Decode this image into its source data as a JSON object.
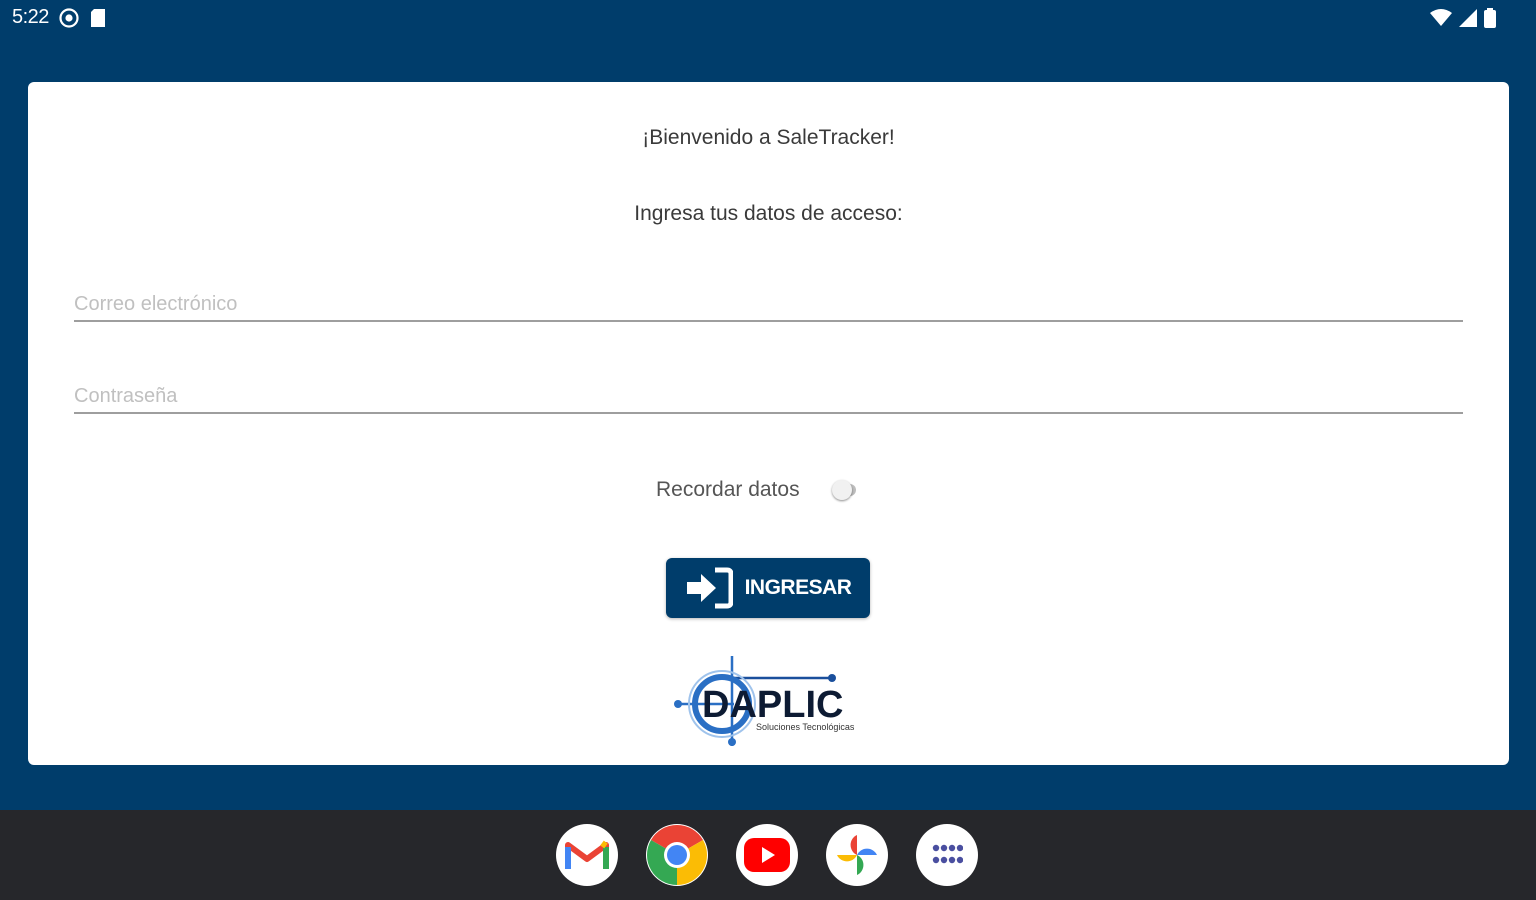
{
  "status_bar": {
    "time": "5:22",
    "left_icons": [
      "settings-circle-icon",
      "sd-card-icon"
    ],
    "right_icons": [
      "wifi-icon",
      "cell-signal-icon",
      "battery-icon"
    ]
  },
  "login": {
    "welcome": "¡Bienvenido a SaleTracker!",
    "prompt": "Ingresa tus datos de acceso:",
    "email_placeholder": "Correo electrónico",
    "email_value": "",
    "password_placeholder": "Contraseña",
    "password_value": "",
    "remember_label": "Recordar datos",
    "remember_enabled": false,
    "button_label": "INGRESAR",
    "button_icon": "sign-in-icon"
  },
  "logo": {
    "name": "DAPLIC",
    "tagline": "Soluciones Tecnológicas"
  },
  "dock": {
    "apps": [
      "gmail-icon",
      "chrome-icon",
      "youtube-icon",
      "photos-icon",
      "app-drawer-icon"
    ]
  },
  "colors": {
    "primary": "#003d6b",
    "card": "#ffffff",
    "nav_bar": "#26272b"
  }
}
